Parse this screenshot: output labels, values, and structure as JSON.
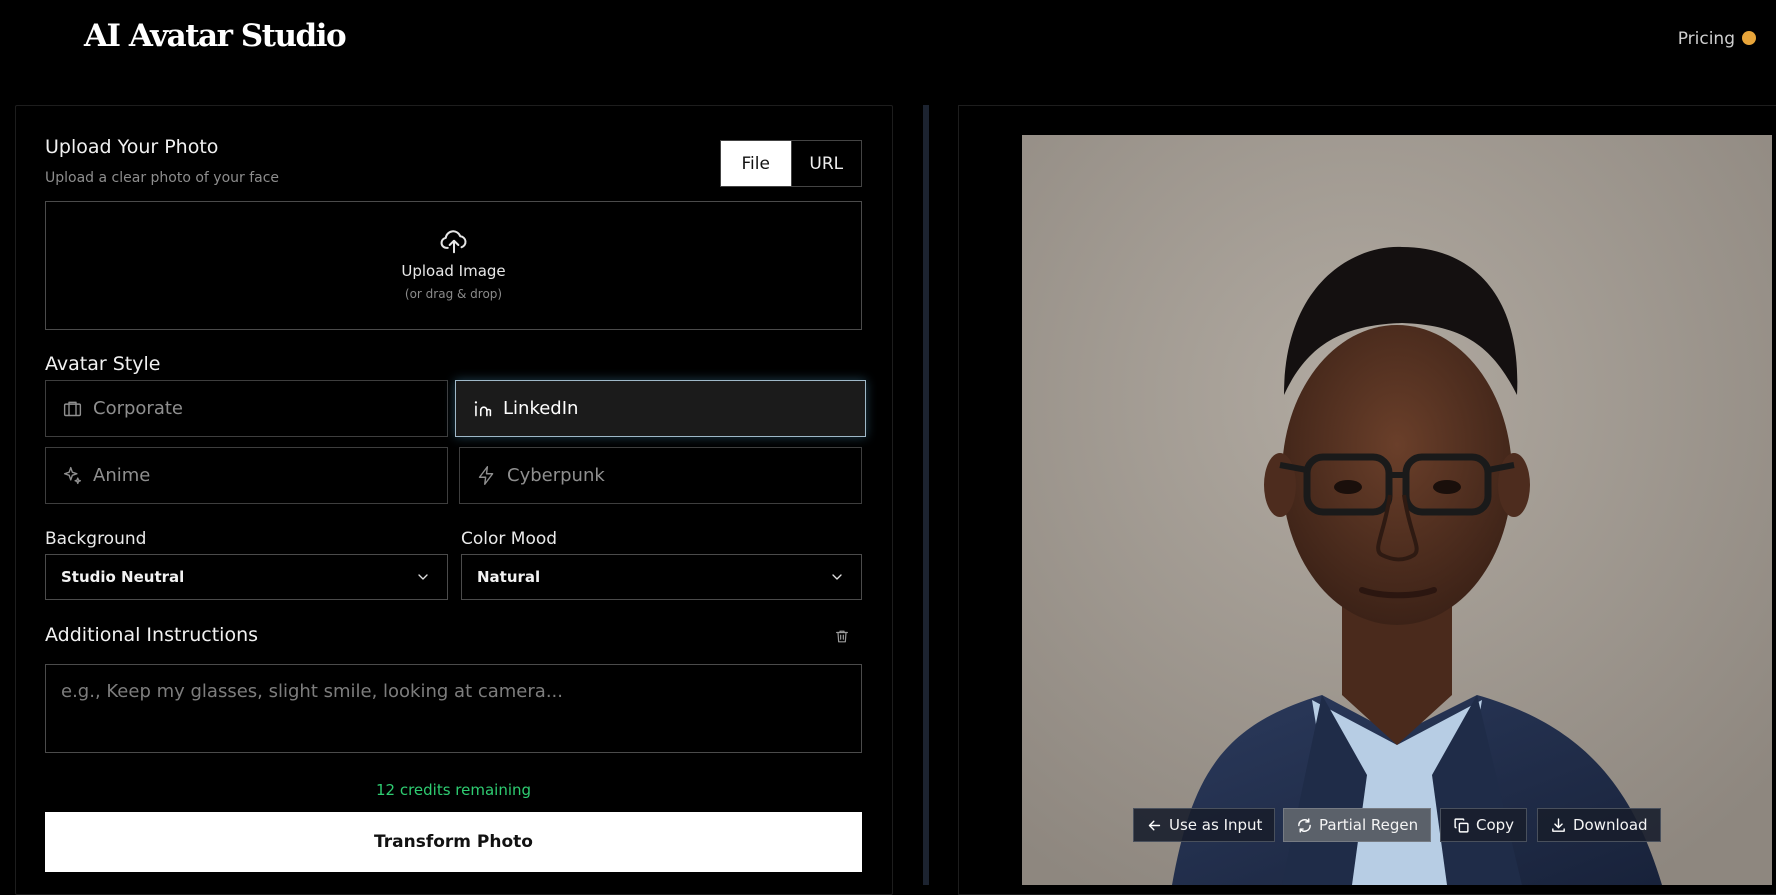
{
  "header": {
    "brand": "AI Avatar Studio",
    "pricing_label": "Pricing"
  },
  "upload": {
    "title": "Upload Your Photo",
    "subtitle": "Upload a clear photo of your face",
    "tabs": [
      {
        "label": "File",
        "active": true
      },
      {
        "label": "URL",
        "active": false
      }
    ],
    "dropzone_label": "Upload Image",
    "dropzone_hint": "(or drag & drop)"
  },
  "avatar_style": {
    "title": "Avatar Style",
    "options": [
      {
        "label": "Corporate",
        "icon": "briefcase-icon",
        "selected": false
      },
      {
        "label": "LinkedIn",
        "icon": "linkedin-icon",
        "selected": true
      },
      {
        "label": "Anime",
        "icon": "sparkles-icon",
        "selected": false
      },
      {
        "label": "Cyberpunk",
        "icon": "lightning-icon",
        "selected": false
      }
    ]
  },
  "background": {
    "label": "Background",
    "value": "Studio Neutral"
  },
  "color_mood": {
    "label": "Color Mood",
    "value": "Natural"
  },
  "instructions": {
    "title": "Additional Instructions",
    "placeholder": "e.g., Keep my glasses, slight smile, looking at camera..."
  },
  "credits_text": "12 credits remaining",
  "transform_label": "Transform Photo",
  "result_actions": [
    {
      "label": "Use as Input",
      "icon": "arrow-left-icon"
    },
    {
      "label": "Partial Regen",
      "icon": "refresh-icon"
    },
    {
      "label": "Copy",
      "icon": "copy-icon"
    },
    {
      "label": "Download",
      "icon": "download-icon"
    }
  ],
  "colors": {
    "accent_selected": "#9fb8c8",
    "credits_green": "#2ecc71",
    "pricing_coin": "#e8a53a"
  }
}
